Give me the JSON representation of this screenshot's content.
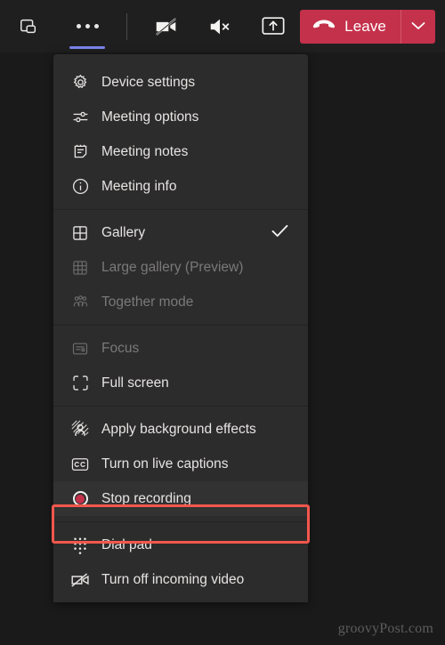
{
  "toolbar": {
    "popout_button": {
      "name": "pop-out",
      "icon": "popout-icon"
    },
    "more_button": {
      "name": "More actions",
      "icon": "ellipsis-icon",
      "active": true
    },
    "camera_button": {
      "name": "Turn camera on",
      "icon": "camera-off-icon"
    },
    "speaker_button": {
      "name": "Mute speaker",
      "icon": "speaker-mute-icon"
    },
    "share_button": {
      "name": "Share content",
      "icon": "share-screen-icon"
    },
    "leave": {
      "label": "Leave",
      "icon": "hangup-icon",
      "caret_icon": "chevron-down-icon",
      "color": "#c4314b"
    }
  },
  "menu": {
    "groups": [
      {
        "items": [
          {
            "label": "Device settings",
            "icon": "gear-icon",
            "disabled": false,
            "checked": false
          },
          {
            "label": "Meeting options",
            "icon": "sliders-icon",
            "disabled": false,
            "checked": false
          },
          {
            "label": "Meeting notes",
            "icon": "notes-icon",
            "disabled": false,
            "checked": false
          },
          {
            "label": "Meeting info",
            "icon": "info-circle-icon",
            "disabled": false,
            "checked": false
          }
        ]
      },
      {
        "items": [
          {
            "label": "Gallery",
            "icon": "grid-2x2-icon",
            "disabled": false,
            "checked": true
          },
          {
            "label": "Large gallery (Preview)",
            "icon": "grid-3x3-icon",
            "disabled": true,
            "checked": false
          },
          {
            "label": "Together mode",
            "icon": "people-icon",
            "disabled": true,
            "checked": false
          }
        ]
      },
      {
        "items": [
          {
            "label": "Focus",
            "icon": "focus-icon",
            "disabled": true,
            "checked": false
          },
          {
            "label": "Full screen",
            "icon": "fullscreen-icon",
            "disabled": false,
            "checked": false
          }
        ]
      },
      {
        "items": [
          {
            "label": "Apply background effects",
            "icon": "background-effects-icon",
            "disabled": false,
            "checked": false
          },
          {
            "label": "Turn on live captions",
            "icon": "closed-captions-icon",
            "disabled": false,
            "checked": false
          },
          {
            "label": "Stop recording",
            "icon": "record-icon",
            "disabled": false,
            "checked": false,
            "highlighted": true
          }
        ]
      },
      {
        "items": [
          {
            "label": "Dial pad",
            "icon": "dialpad-icon",
            "disabled": false,
            "checked": false
          },
          {
            "label": "Turn off incoming video",
            "icon": "camera-off-icon",
            "disabled": false,
            "checked": false
          }
        ]
      }
    ]
  },
  "annotation": {
    "highlight_color": "#f4574c",
    "target": "Stop recording"
  },
  "watermark": {
    "text": "groovyPost.com"
  }
}
